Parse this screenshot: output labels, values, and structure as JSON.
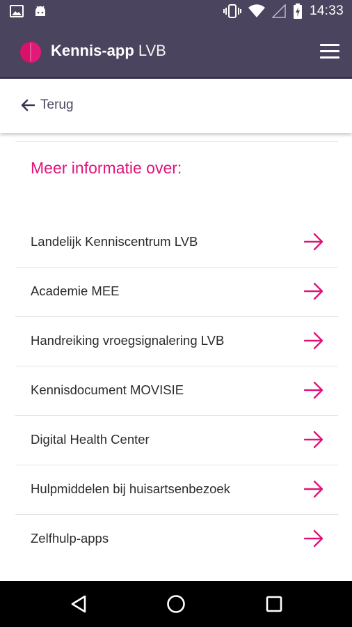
{
  "status_bar": {
    "time": "14:33",
    "left_icons": [
      "image-icon",
      "android-icon"
    ],
    "right_icons": [
      "vibrate-icon",
      "wifi-icon",
      "cellular-icon",
      "battery-charging-icon"
    ]
  },
  "app_bar": {
    "title_bold": "Kennis-app",
    "title_light": " LVB",
    "menu_icon": "hamburger-menu-icon"
  },
  "back": {
    "label": "Terug",
    "icon": "arrow-left-icon"
  },
  "section": {
    "title": "Meer informatie over:"
  },
  "items": [
    {
      "label": "Landelijk Kenniscentrum LVB"
    },
    {
      "label": "Academie MEE"
    },
    {
      "label": "Handreiking vroegsignalering LVB"
    },
    {
      "label": "Kennisdocument MOVISIE"
    },
    {
      "label": "Digital Health Center"
    },
    {
      "label": "Hulpmiddelen bij huisartsenbezoek"
    },
    {
      "label": "Zelfhulp-apps"
    }
  ],
  "colors": {
    "header": "#4a445e",
    "accent": "#e0137a",
    "nav": "#000000"
  },
  "nav_bar": [
    "back-triangle-icon",
    "home-circle-icon",
    "recents-square-icon"
  ]
}
